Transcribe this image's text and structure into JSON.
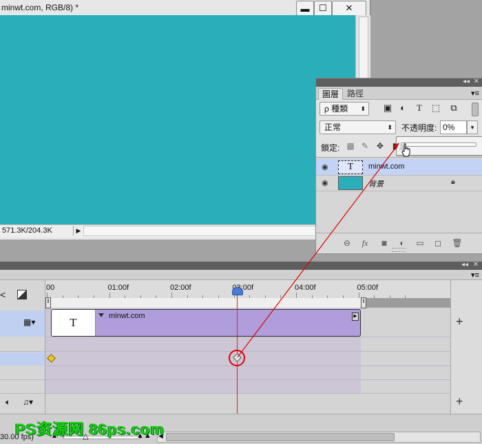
{
  "document": {
    "title": "minwt.com, RGB/8) *",
    "window_controls": {
      "minimize": "▬",
      "maximize": "☐",
      "close": "✕"
    },
    "status": "571.3K/204.3K",
    "status_arrow": "▶",
    "canvas_color": "#2aaeba"
  },
  "layers_panel": {
    "tabs": [
      "圖層",
      "路徑"
    ],
    "active_tab": "圖層",
    "filter_label": "ρ 種類",
    "filter_icons": [
      "image-icon",
      "adjustment-icon",
      "type-icon",
      "shape-icon",
      "smart-object-icon"
    ],
    "blend_mode": "正常",
    "opacity_label": "不透明度:",
    "opacity_value": "0%",
    "lock_label": "鎖定:",
    "layers": [
      {
        "name": "minwt.com",
        "selected": true,
        "thumb": "T"
      },
      {
        "name": "背景",
        "selected": false,
        "locked": true
      }
    ],
    "opacity_slider_value": 0
  },
  "timeline": {
    "ticks": [
      "00",
      "01:00f",
      "02:00f",
      "03:00f",
      "04:00f",
      "05:00f"
    ],
    "clip_label": "minwt.com",
    "clip_thumb": "T",
    "playhead_time": "03:00f",
    "fps": "30.00 fps)",
    "add_label": "+"
  },
  "watermark": "PS资源网  86ps.com",
  "colors": {
    "clip": "#b09ddb",
    "playhead": "#e22222",
    "keyframe_active": "#f0c820",
    "selection": "#c3d3f5",
    "watermark": "#19d400"
  }
}
